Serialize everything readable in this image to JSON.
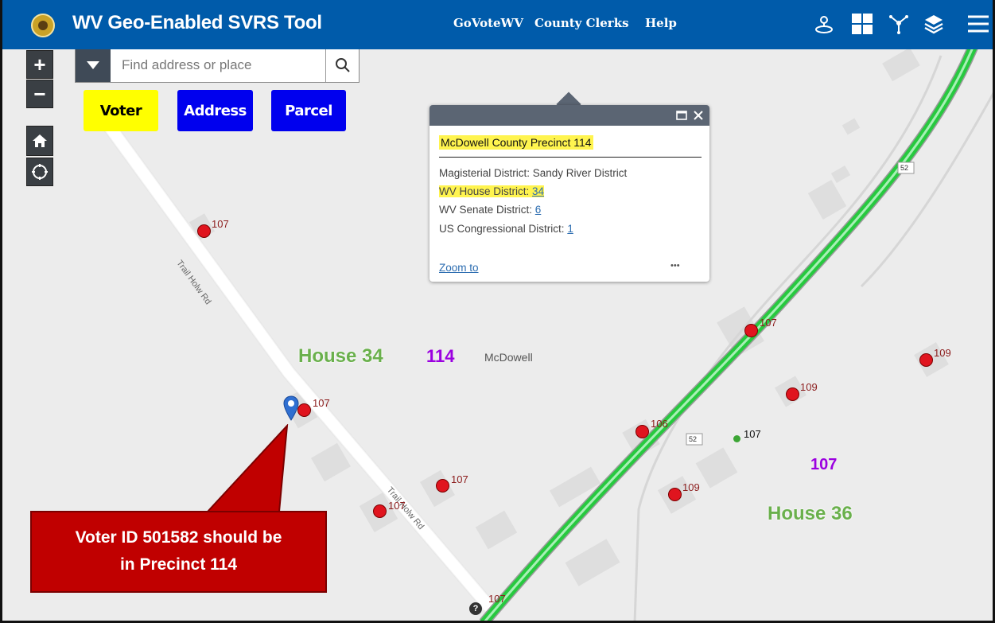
{
  "header": {
    "title": "WV Geo-Enabled SVRS Tool",
    "links": [
      "GoVoteWV",
      "County Clerks",
      "Help"
    ],
    "icons": [
      "location-share-icon",
      "grid-icon",
      "network-icon",
      "layers-icon",
      "menu-icon"
    ]
  },
  "search": {
    "placeholder": "Find address or place"
  },
  "query_buttons": [
    {
      "label": "Voter",
      "bg": "#ffff00",
      "fg": "#000000"
    },
    {
      "label": "Address",
      "bg": "#0000ee",
      "fg": "#ffffff"
    },
    {
      "label": "Parcel",
      "bg": "#0000ee",
      "fg": "#ffffff"
    }
  ],
  "popup": {
    "title": "McDowell County Precinct 114",
    "magisterial": "Magisterial District: Sandy River District",
    "house_label": "WV House District: ",
    "house_value": "34",
    "senate_label": "WV Senate District: ",
    "senate_value": "6",
    "congress_label": "US Congressional District: ",
    "congress_value": "1",
    "zoom": "Zoom to",
    "more": "•••"
  },
  "map": {
    "road_name": "Trail Holw Rd",
    "highway_shield": "52",
    "labels": {
      "house34": "House 34",
      "precinct114": "114",
      "county": "McDowell",
      "precinct107": "107",
      "house36": "House 36"
    },
    "points": [
      "107",
      "107",
      "107",
      "107",
      "107",
      "106",
      "107",
      "109",
      "109",
      "109",
      "107",
      "107"
    ],
    "colors": {
      "house": "#6ab04c",
      "precinct": "#9b00e0",
      "highway": "#27c93f",
      "point": "#e0141e"
    }
  },
  "callout": {
    "line1": "Voter ID 501582 should be",
    "line2": "in Precinct 114"
  }
}
